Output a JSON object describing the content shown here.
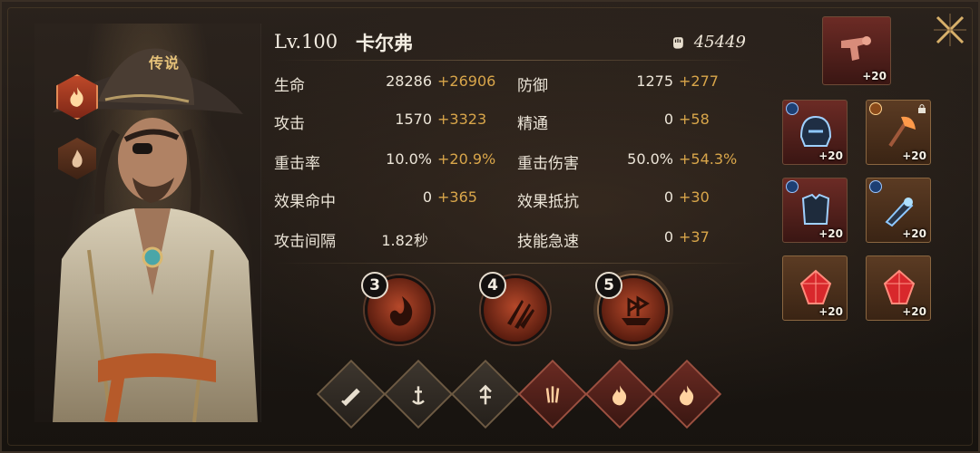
{
  "hero": {
    "rarity": "传说",
    "level": "Lv.100",
    "name": "卡尔弗",
    "power": "45449"
  },
  "stats": [
    {
      "label": "生命",
      "base": "28286",
      "bonus": "+26906"
    },
    {
      "label": "防御",
      "base": "1275",
      "bonus": "+277"
    },
    {
      "label": "攻击",
      "base": "1570",
      "bonus": "+3323"
    },
    {
      "label": "精通",
      "base": "0",
      "bonus": "+58"
    },
    {
      "label": "重击率",
      "base": "10.0%",
      "bonus": "+20.9%"
    },
    {
      "label": "重击伤害",
      "base": "50.0%",
      "bonus": "+54.3%"
    },
    {
      "label": "效果命中",
      "base": "0",
      "bonus": "+365"
    },
    {
      "label": "效果抵抗",
      "base": "0",
      "bonus": "+30"
    },
    {
      "label": "攻击间隔",
      "base": "1.82秒",
      "bonus": ""
    },
    {
      "label": "技能急速",
      "base": "0",
      "bonus": "+37"
    }
  ],
  "skills": [
    {
      "level": "3",
      "icon": "flame-swirl-icon"
    },
    {
      "level": "4",
      "icon": "daggers-icon"
    },
    {
      "level": "5",
      "icon": "ship-icon"
    }
  ],
  "runes": [
    {
      "icon": "sword-icon",
      "color": "neutral"
    },
    {
      "icon": "anchor-sword-icon",
      "color": "neutral"
    },
    {
      "icon": "arrow-up-icon",
      "color": "neutral"
    },
    {
      "icon": "claw-icon",
      "color": "red"
    },
    {
      "icon": "fire-icon",
      "color": "red"
    },
    {
      "icon": "fire-icon",
      "color": "red"
    }
  ],
  "equipment": [
    {
      "slot": "weapon-top",
      "enh": "+20",
      "icon": "pistol-icon",
      "color": "red"
    },
    {
      "slot": "helmet",
      "enh": "+20",
      "icon": "helmet-icon",
      "color": "red"
    },
    {
      "slot": "axe",
      "enh": "+20",
      "icon": "axe-icon",
      "color": "gold"
    },
    {
      "slot": "armor",
      "enh": "+20",
      "icon": "armor-icon",
      "color": "red"
    },
    {
      "slot": "gauntlet",
      "enh": "+20",
      "icon": "gauntlet-icon",
      "color": "gold"
    },
    {
      "slot": "gem-1",
      "enh": "+20",
      "icon": "red-gem-icon",
      "color": "gold"
    },
    {
      "slot": "gem-2",
      "enh": "+20",
      "icon": "red-gem-icon",
      "color": "gold"
    }
  ],
  "colors": {
    "bonus": "#d9a64a",
    "rarity": "#e7c37a",
    "accent_red": "#c04a2a"
  }
}
